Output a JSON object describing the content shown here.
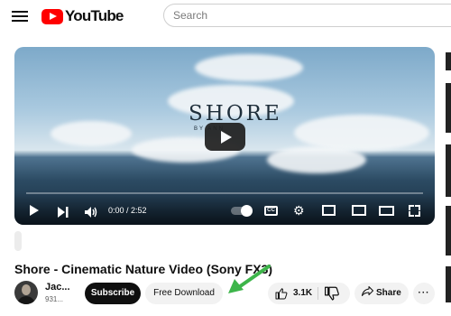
{
  "header": {
    "logo_text": "YouTube",
    "search_placeholder": "Search"
  },
  "player": {
    "overlay_title": "SHORE",
    "overlay_byline": "BY                ANN",
    "time": "0:00 / 2:52",
    "cc_label": "CC"
  },
  "video": {
    "title": "Shore - Cinematic Nature Video (Sony FX3)",
    "channel_name": "Jac...",
    "subscriber_count": "931...",
    "subscribe_label": "Subscribe",
    "download_label": "Free Download",
    "like_count": "3.1K",
    "share_label": "Share",
    "more_label": "···"
  },
  "colors": {
    "brand": "#ff0000",
    "annotation_arrow": "#3db54a"
  }
}
